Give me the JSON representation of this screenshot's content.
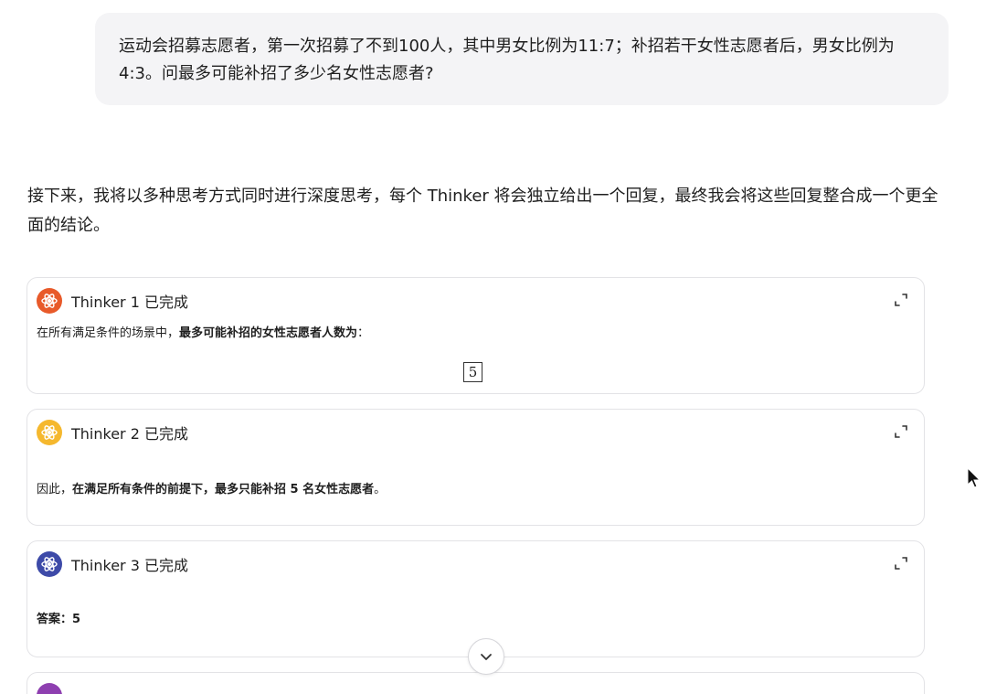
{
  "user_message": "运动会招募志愿者，第一次招募了不到100人，其中男女比例为11:7；补招若干女性志愿者后，男女比例为4:3。问最多可能补招了多少名女性志愿者?",
  "assistant_intro": "接下来，我将以多种思考方式同时进行深度思考，每个 Thinker 将会独立给出一个回复，最终我会将这些回复整合成一个更全面的结论。",
  "thinkers": [
    {
      "title": "Thinker 1 已完成",
      "color": "#e85a2a",
      "body_prefix": "在所有满足条件的场景中，",
      "body_bold": "最多可能补招的女性志愿者人数为",
      "body_suffix": "：",
      "answer_box": "5"
    },
    {
      "title": "Thinker 2 已完成",
      "color": "#f5b82e",
      "body_prefix": "因此，",
      "body_bold": "在满足所有条件的前提下，最多只能补招 5 名女性志愿者",
      "body_suffix": "。"
    },
    {
      "title": "Thinker 3 已完成",
      "color": "#3d4aa8",
      "body_bold": "答案：5"
    }
  ],
  "next_thinker_color": "#8e3fb0",
  "icons": {
    "thinker": "atom-icon",
    "expand": "expand-icon",
    "scroll": "chevron-down-icon",
    "cursor": "mouse-cursor-icon"
  }
}
